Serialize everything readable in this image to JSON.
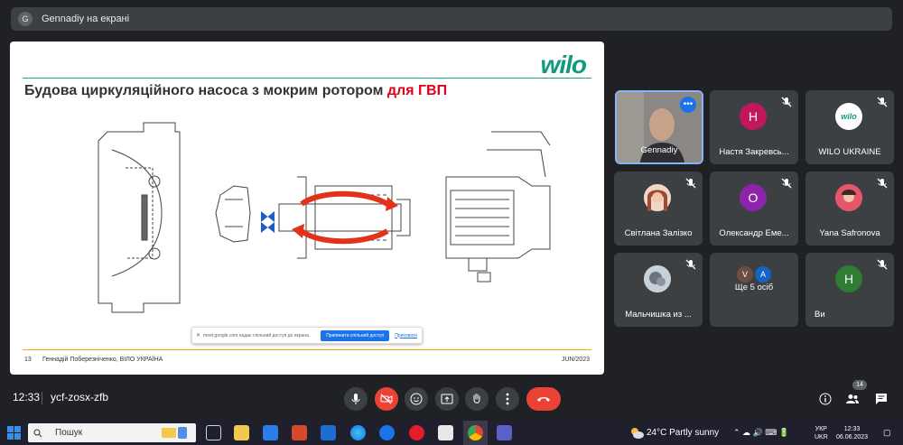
{
  "presenter": {
    "avatar_initial": "G",
    "text": "Gennadiy на екрані"
  },
  "slide": {
    "logo": "wilo",
    "title_main": "Будова циркуляційного насоса з мокрим ротором ",
    "title_accent": "для ГВП",
    "footer_page": "13",
    "footer_author": "Геннадій Поберезніченко, ВІЛО УКРАЇНА",
    "footer_date": "JUN/2023"
  },
  "share_notification": {
    "text": "meet.google.com надає спільний доступ до екрана.",
    "stop_label": "Припинити спільний доступ",
    "hide_label": "Приховати"
  },
  "participants": [
    {
      "name": "Gennadiy",
      "type": "video"
    },
    {
      "name": "Настя Закревсь...",
      "initial": "Н",
      "color": "#c2185b"
    },
    {
      "name": "WILO UKRAINE",
      "initial": "wilo",
      "color": "#ffffff"
    },
    {
      "name": "Світлана Залізко",
      "type": "photo"
    },
    {
      "name": "Олександр Еме...",
      "initial": "О",
      "color": "#8e24aa"
    },
    {
      "name": "Yana Safronova",
      "type": "photo"
    },
    {
      "name": "Мальчишка из ...",
      "type": "photo"
    },
    {
      "name": "Ще 5 осіб",
      "initials": [
        "V",
        "A"
      ]
    },
    {
      "name": "Ви",
      "initial": "Н",
      "color": "#2e7d32"
    }
  ],
  "bottom_bar": {
    "time": "12:33",
    "meeting_code": "ycf-zosx-zfb",
    "people_count": "14"
  },
  "taskbar": {
    "search_placeholder": "Пошук",
    "weather": "24°C  Partly sunny",
    "lang": "УКР",
    "lang2": "UKR",
    "clock_time": "12:33",
    "clock_date": "06.06.2023"
  }
}
